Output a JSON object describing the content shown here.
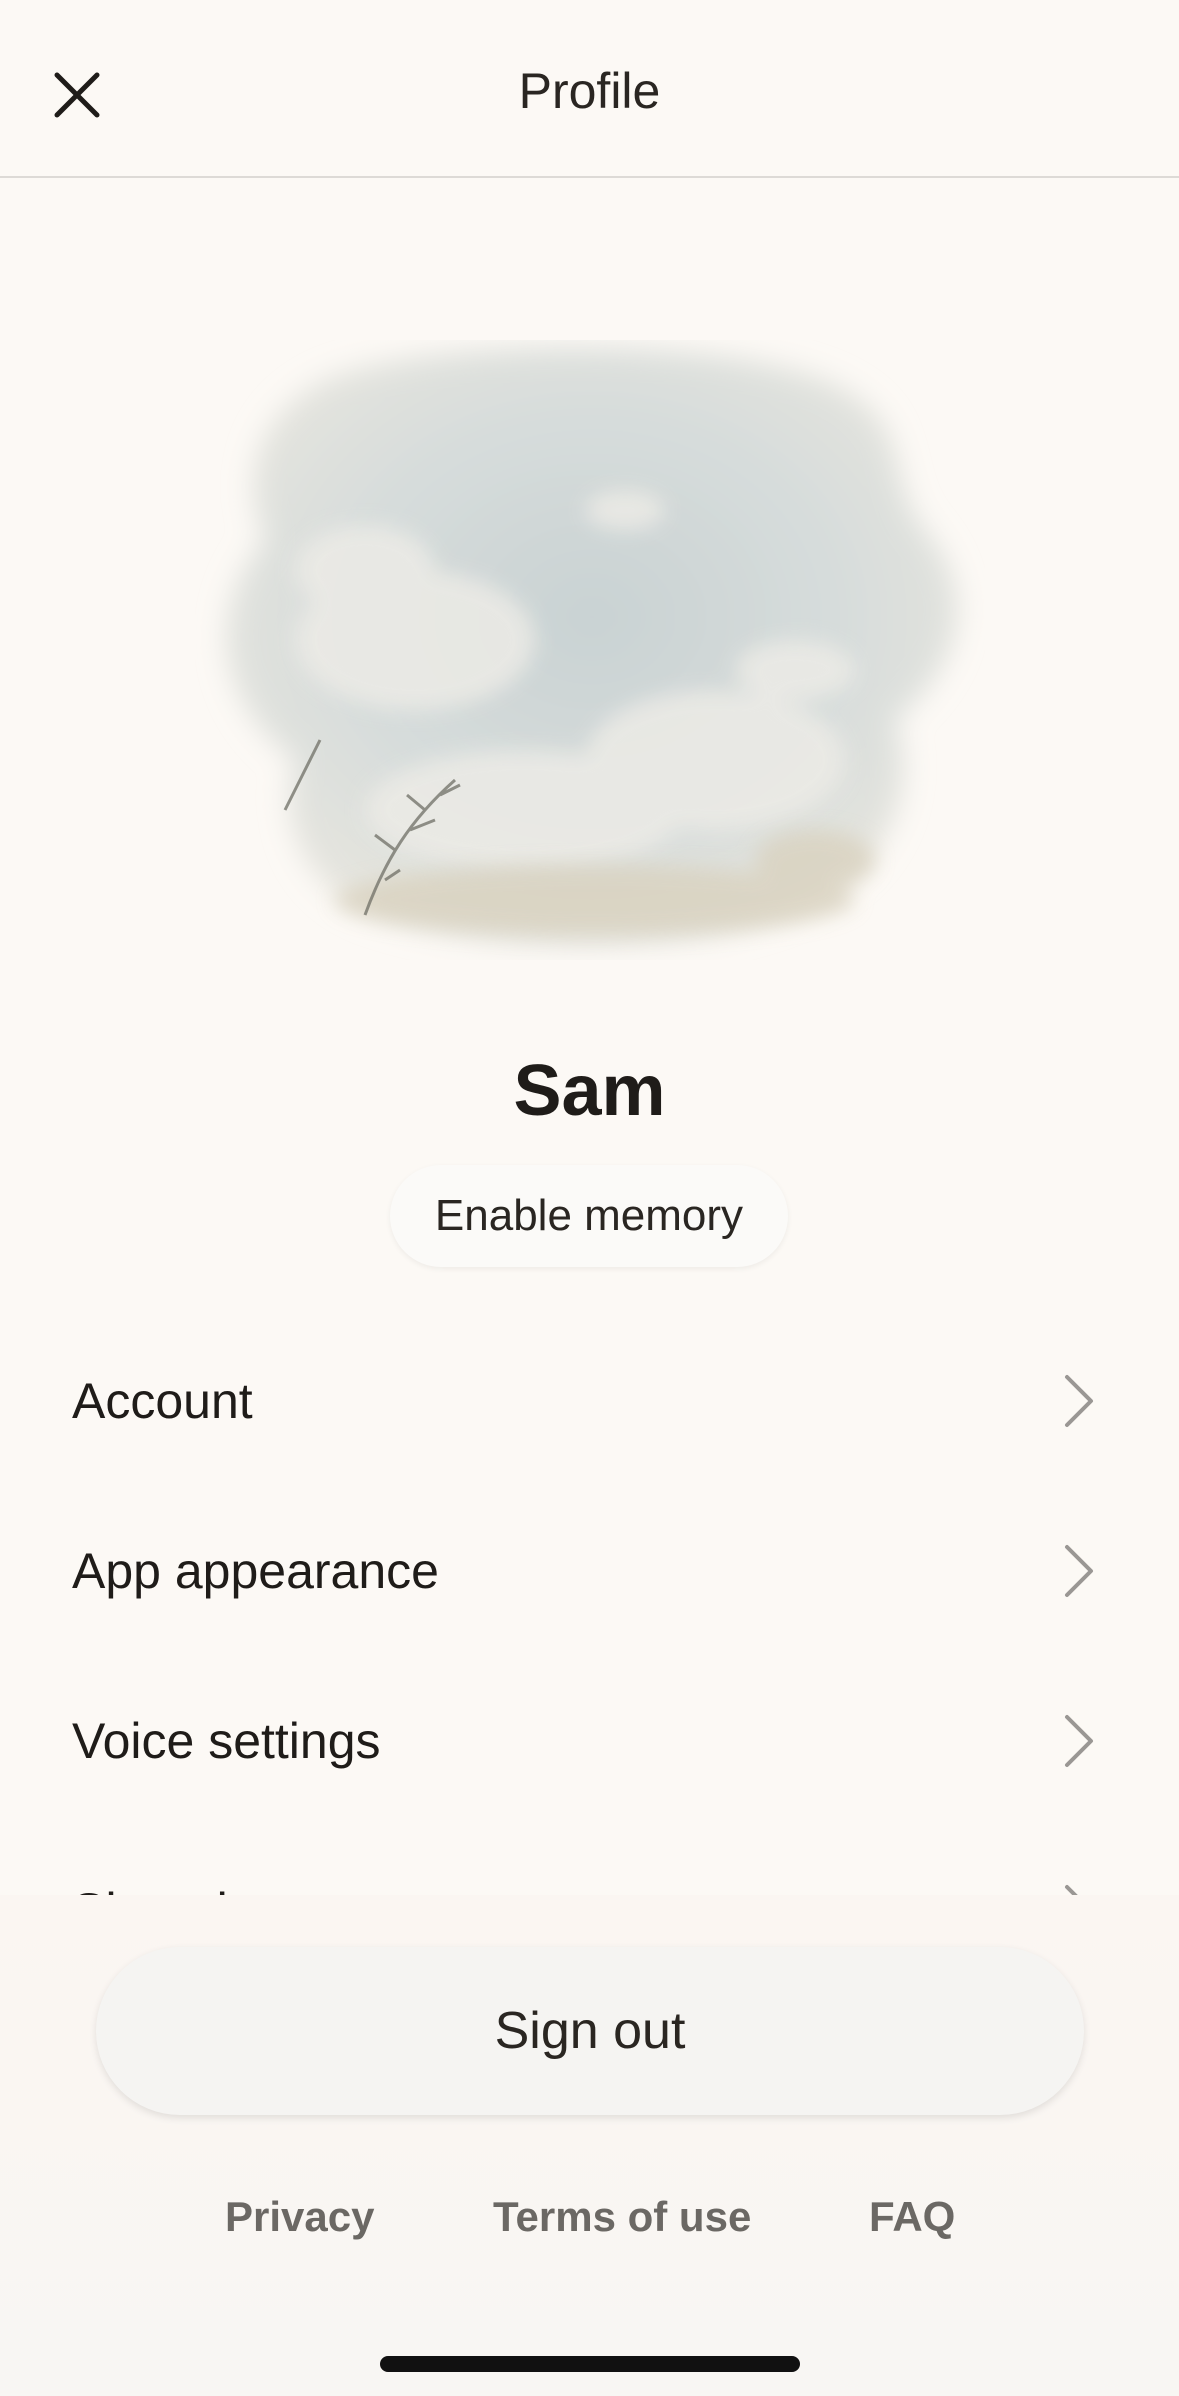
{
  "header": {
    "title": "Profile",
    "close_icon": "close-icon"
  },
  "profile": {
    "name": "Sam",
    "enable_memory_label": "Enable memory",
    "avatar_icon": "cloud-landscape-avatar"
  },
  "menu": {
    "items": [
      {
        "label": "Account",
        "icon": "chevron-right-icon"
      },
      {
        "label": "App appearance",
        "icon": "chevron-right-icon"
      },
      {
        "label": "Voice settings",
        "icon": "chevron-right-icon"
      },
      {
        "label": "Shopping",
        "icon": "chevron-right-icon"
      }
    ]
  },
  "actions": {
    "sign_out_label": "Sign out"
  },
  "footer": {
    "privacy": "Privacy",
    "terms": "Terms of use",
    "faq": "FAQ"
  },
  "colors": {
    "background": "#fcf9f5",
    "text": "#1f1c19",
    "footer_link": "#6b6864",
    "chevron": "#9a9794"
  }
}
